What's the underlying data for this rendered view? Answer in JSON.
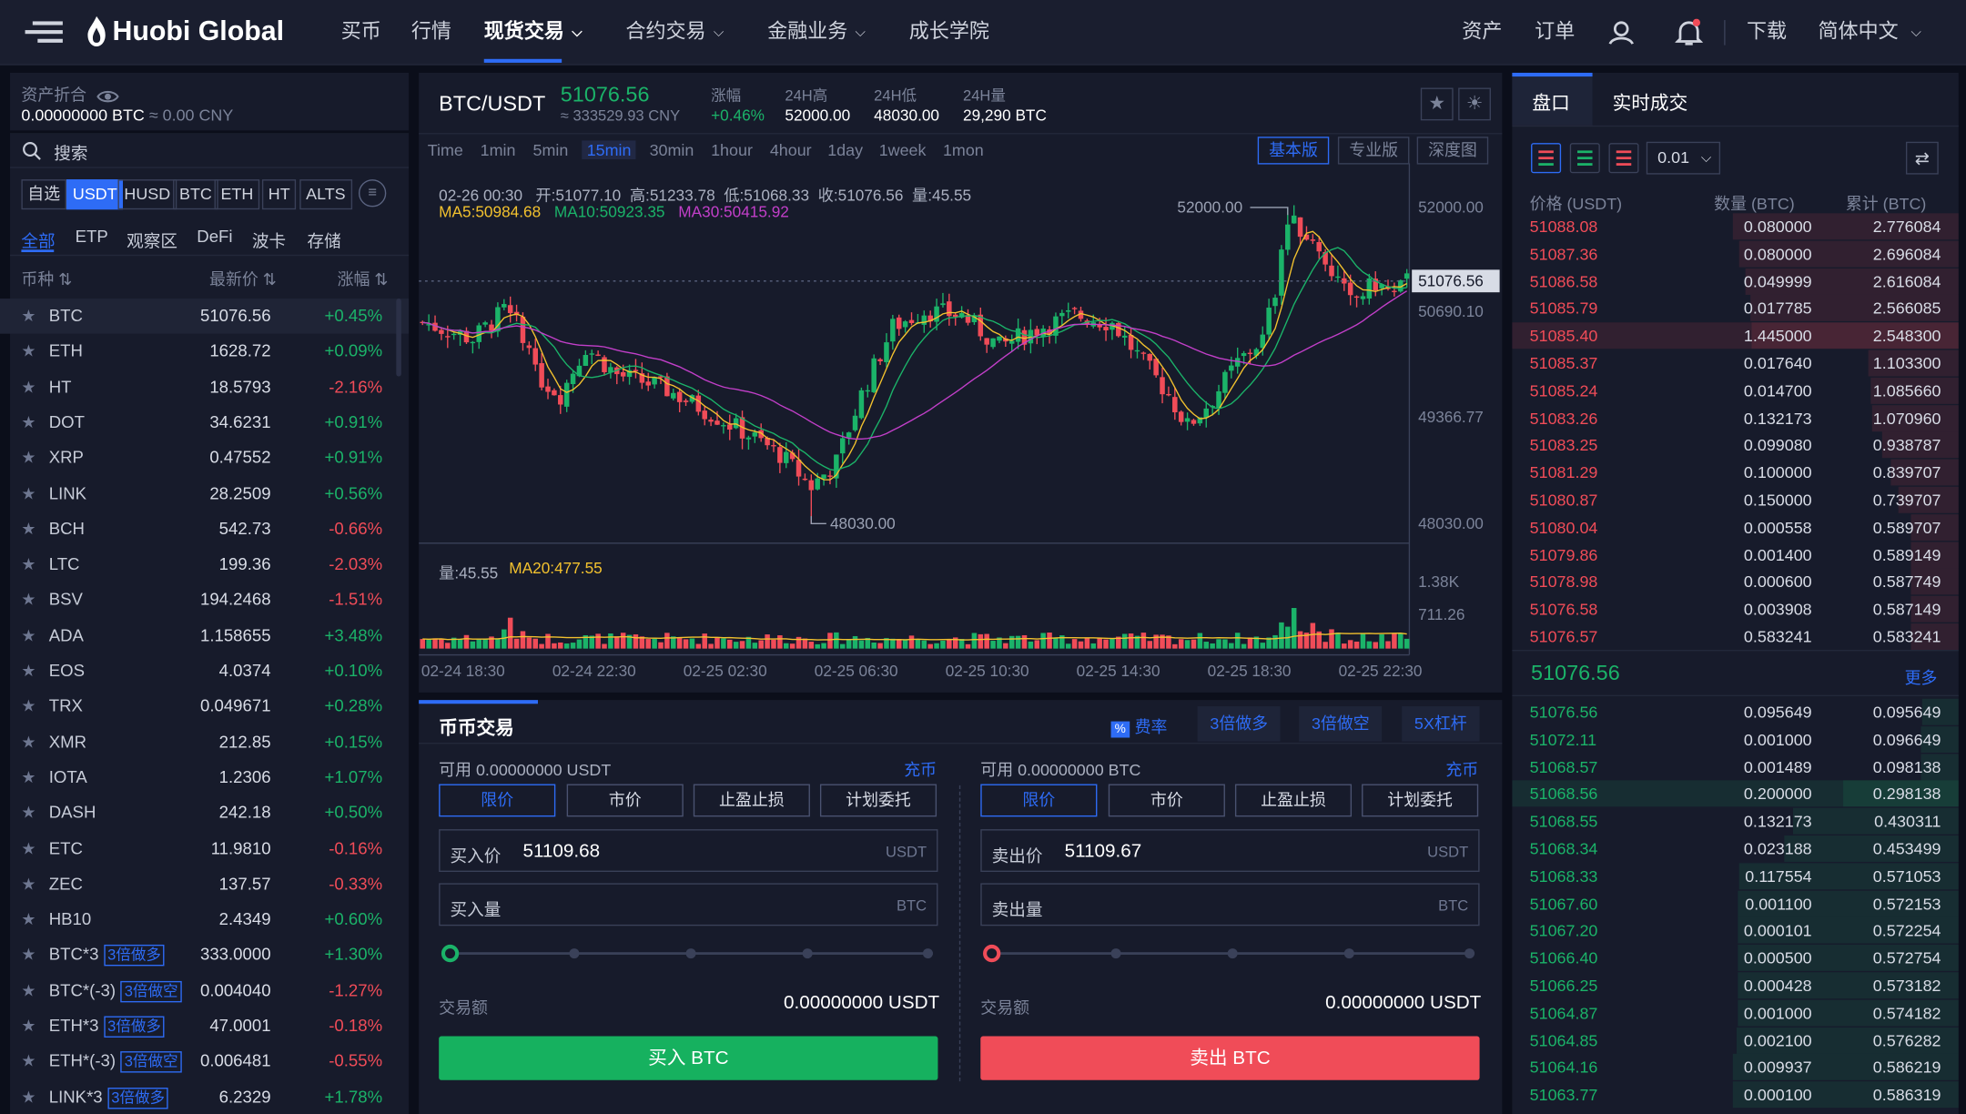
{
  "header": {
    "logo_text": "Huobi Global",
    "nav": [
      {
        "label": "买币"
      },
      {
        "label": "行情"
      },
      {
        "label": "现货交易"
      },
      {
        "label": "合约交易"
      },
      {
        "label": "金融业务"
      },
      {
        "label": "成长学院"
      }
    ],
    "right": {
      "assets": "资产",
      "orders": "订单",
      "download": "下载",
      "language": "简体中文"
    }
  },
  "assets_panel": {
    "title": "资产折合",
    "btc_value": "0.00000000 BTC",
    "cny_value": "≈ 0.00 CNY"
  },
  "search": {
    "placeholder": "搜索"
  },
  "quote_tabs": [
    "自选",
    "USDT",
    "HUSD",
    "BTC",
    "ETH",
    "HT",
    "ALTS"
  ],
  "category_tabs": [
    "全部",
    "ETP",
    "观察区",
    "DeFi",
    "波卡",
    "存储"
  ],
  "market_columns": {
    "symbol": "币种",
    "price": "最新价",
    "change": "涨幅"
  },
  "markets": [
    {
      "symbol": "BTC",
      "price": "51076.56",
      "change": "+0.45%"
    },
    {
      "symbol": "ETH",
      "price": "1628.72",
      "change": "+0.09%"
    },
    {
      "symbol": "HT",
      "price": "18.5793",
      "change": "-2.16%"
    },
    {
      "symbol": "DOT",
      "price": "34.6231",
      "change": "+0.91%"
    },
    {
      "symbol": "XRP",
      "price": "0.47552",
      "change": "+0.91%"
    },
    {
      "symbol": "LINK",
      "price": "28.2509",
      "change": "+0.56%"
    },
    {
      "symbol": "BCH",
      "price": "542.73",
      "change": "-0.66%"
    },
    {
      "symbol": "LTC",
      "price": "199.36",
      "change": "-2.03%"
    },
    {
      "symbol": "BSV",
      "price": "194.2468",
      "change": "-1.51%"
    },
    {
      "symbol": "ADA",
      "price": "1.158655",
      "change": "+3.48%"
    },
    {
      "symbol": "EOS",
      "price": "4.0374",
      "change": "+0.10%"
    },
    {
      "symbol": "TRX",
      "price": "0.049671",
      "change": "+0.28%"
    },
    {
      "symbol": "XMR",
      "price": "212.85",
      "change": "+0.15%"
    },
    {
      "symbol": "IOTA",
      "price": "1.2306",
      "change": "+1.07%"
    },
    {
      "symbol": "DASH",
      "price": "242.18",
      "change": "+0.50%"
    },
    {
      "symbol": "ETC",
      "price": "11.9810",
      "change": "-0.16%"
    },
    {
      "symbol": "ZEC",
      "price": "137.57",
      "change": "-0.33%"
    },
    {
      "symbol": "HB10",
      "price": "2.4349",
      "change": "+0.60%"
    },
    {
      "symbol": "BTC*3",
      "tag": "3倍做多",
      "price": "333.0000",
      "change": "+1.30%"
    },
    {
      "symbol": "BTC*(-3)",
      "tag": "3倍做空",
      "price": "0.004040",
      "change": "-1.27%"
    },
    {
      "symbol": "ETH*3",
      "tag": "3倍做多",
      "price": "47.0001",
      "change": "-0.18%"
    },
    {
      "symbol": "ETH*(-3)",
      "tag": "3倍做空",
      "price": "0.006481",
      "change": "-0.55%"
    },
    {
      "symbol": "LINK*3",
      "tag": "3倍做多",
      "price": "6.2329",
      "change": "+1.78%"
    }
  ],
  "ticker": {
    "pair": "BTC/USDT",
    "price": "51076.56",
    "cny": "≈ 333529.93 CNY",
    "change_label": "涨幅",
    "change": "+0.46%",
    "high_label": "24H高",
    "high": "52000.00",
    "low_label": "24H低",
    "low": "48030.00",
    "vol_label": "24H量",
    "vol": "29,290 BTC"
  },
  "timeframes": [
    "Time",
    "1min",
    "5min",
    "15min",
    "30min",
    "1hour",
    "4hour",
    "1day",
    "1week",
    "1mon"
  ],
  "chart_views": [
    "基本版",
    "专业版",
    "深度图"
  ],
  "chart_info": {
    "ohlc": "02-26 00:30   开:51077.10  高:51233.78  低:51068.33  收:51076.56  量:45.55",
    "ma5": "MA5:50984.68",
    "ma10": "MA10:50923.35",
    "ma30": "MA30:50415.92",
    "vol": "量:45.55",
    "ma20": "MA20:477.55",
    "high_mark": "52000.00",
    "low_mark": "48030.00"
  },
  "chart_data": {
    "type": "candlestick",
    "price_axis": [
      "52000.00",
      "50690.10",
      "49366.77",
      "48030.00"
    ],
    "current_price": "51076.56",
    "volume_axis": [
      "1.38K",
      "711.26"
    ],
    "time_axis": [
      "02-24 18:30",
      "02-24 22:30",
      "02-25 02:30",
      "02-25 06:30",
      "02-25 10:30",
      "02-25 14:30",
      "02-25 18:30",
      "02-25 22:30"
    ],
    "ylim": [
      47800,
      52400
    ],
    "colors": {
      "up": "#1bb369",
      "down": "#f04c58",
      "ma5": "#f2c12e",
      "ma10": "#1bb369",
      "ma30": "#c23fc9"
    }
  },
  "trade": {
    "title": "币币交易",
    "fee": "费率",
    "badges": [
      "3倍做多",
      "3倍做空",
      "5X杠杆"
    ],
    "buy": {
      "available": "可用  0.00000000 USDT",
      "deposit": "充币",
      "types": [
        "限价",
        "市价",
        "止盈止损",
        "计划委托"
      ],
      "price_label": "买入价",
      "price": "51109.68",
      "price_unit": "USDT",
      "amount_label": "买入量",
      "amount_unit": "BTC",
      "total_label": "交易额",
      "total": "0.00000000 USDT",
      "button": "买入 BTC"
    },
    "sell": {
      "available": "可用  0.00000000 BTC",
      "deposit": "充币",
      "types": [
        "限价",
        "市价",
        "止盈止损",
        "计划委托"
      ],
      "price_label": "卖出价",
      "price": "51109.67",
      "price_unit": "USDT",
      "amount_label": "卖出量",
      "amount_unit": "BTC",
      "total_label": "交易额",
      "total": "0.00000000 USDT",
      "button": "卖出 BTC"
    }
  },
  "orderbook": {
    "tabs": [
      "盘口",
      "实时成交"
    ],
    "precision": "0.01",
    "columns": [
      "价格 (USDT)",
      "数量 (BTC)",
      "累计 (BTC)"
    ],
    "asks": [
      [
        "51088.08",
        "0.080000",
        "2.776084"
      ],
      [
        "51087.36",
        "0.080000",
        "2.696084"
      ],
      [
        "51086.58",
        "0.049999",
        "2.616084"
      ],
      [
        "51085.79",
        "0.017785",
        "2.566085"
      ],
      [
        "51085.40",
        "1.445000",
        "2.548300"
      ],
      [
        "51085.37",
        "0.017640",
        "1.103300"
      ],
      [
        "51085.24",
        "0.014700",
        "1.085660"
      ],
      [
        "51083.26",
        "0.132173",
        "1.070960"
      ],
      [
        "51083.25",
        "0.099080",
        "0.938787"
      ],
      [
        "51081.29",
        "0.100000",
        "0.839707"
      ],
      [
        "51080.87",
        "0.150000",
        "0.739707"
      ],
      [
        "51080.04",
        "0.000558",
        "0.589707"
      ],
      [
        "51079.86",
        "0.001400",
        "0.589149"
      ],
      [
        "51078.98",
        "0.000600",
        "0.587749"
      ],
      [
        "51076.58",
        "0.003908",
        "0.587149"
      ],
      [
        "51076.57",
        "0.583241",
        "0.583241"
      ]
    ],
    "last_price": "51076.56",
    "more": "更多",
    "bids": [
      [
        "51076.56",
        "0.095649",
        "0.095649"
      ],
      [
        "51072.11",
        "0.001000",
        "0.096649"
      ],
      [
        "51068.57",
        "0.001489",
        "0.098138"
      ],
      [
        "51068.56",
        "0.200000",
        "0.298138"
      ],
      [
        "51068.55",
        "0.132173",
        "0.430311"
      ],
      [
        "51068.34",
        "0.023188",
        "0.453499"
      ],
      [
        "51068.33",
        "0.117554",
        "0.571053"
      ],
      [
        "51067.60",
        "0.001100",
        "0.572153"
      ],
      [
        "51067.20",
        "0.000101",
        "0.572254"
      ],
      [
        "51066.40",
        "0.000500",
        "0.572754"
      ],
      [
        "51066.25",
        "0.000428",
        "0.573182"
      ],
      [
        "51064.87",
        "0.001000",
        "0.574182"
      ],
      [
        "51064.85",
        "0.002100",
        "0.576282"
      ],
      [
        "51064.16",
        "0.009937",
        "0.586219"
      ],
      [
        "51063.77",
        "0.000100",
        "0.586319"
      ]
    ]
  }
}
